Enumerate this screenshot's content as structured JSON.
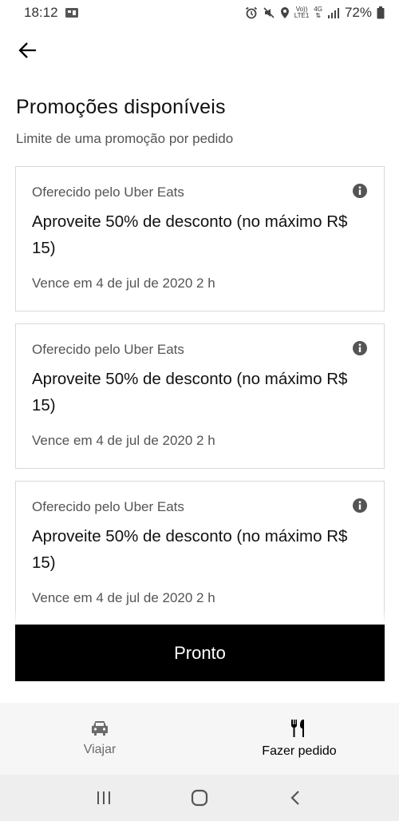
{
  "status_bar": {
    "time": "18:12",
    "network_top": "Vo))",
    "network_bottom": "LTE1",
    "data_top": "4G",
    "battery": "72%"
  },
  "header": {
    "title": "Promoções disponíveis",
    "subtitle": "Limite de uma promoção por pedido"
  },
  "promotions": [
    {
      "offered_by": "Oferecido pelo Uber Eats",
      "title": "Aproveite 50% de desconto (no máximo R$ 15)",
      "expires": "Vence em 4 de jul de 2020 2 h"
    },
    {
      "offered_by": "Oferecido pelo Uber Eats",
      "title": "Aproveite 50% de desconto (no máximo R$ 15)",
      "expires": "Vence em 4 de jul de 2020 2 h"
    },
    {
      "offered_by": "Oferecido pelo Uber Eats",
      "title": "Aproveite 50% de desconto (no máximo R$ 15)",
      "expires": "Vence em 4 de jul de 2020 2 h"
    }
  ],
  "done_button": "Pronto",
  "bottom_nav": {
    "items": [
      {
        "label": "Viajar",
        "icon": "car-icon",
        "active": false
      },
      {
        "label": "Fazer pedido",
        "icon": "fork-knife-icon",
        "active": true
      }
    ]
  },
  "system_nav": [
    "recent-apps-icon",
    "home-icon",
    "back-icon"
  ],
  "colors": {
    "primary": "#000000",
    "secondary_text": "#545454",
    "card_border": "#d9d9d9",
    "nav_bg": "#f6f6f6"
  }
}
